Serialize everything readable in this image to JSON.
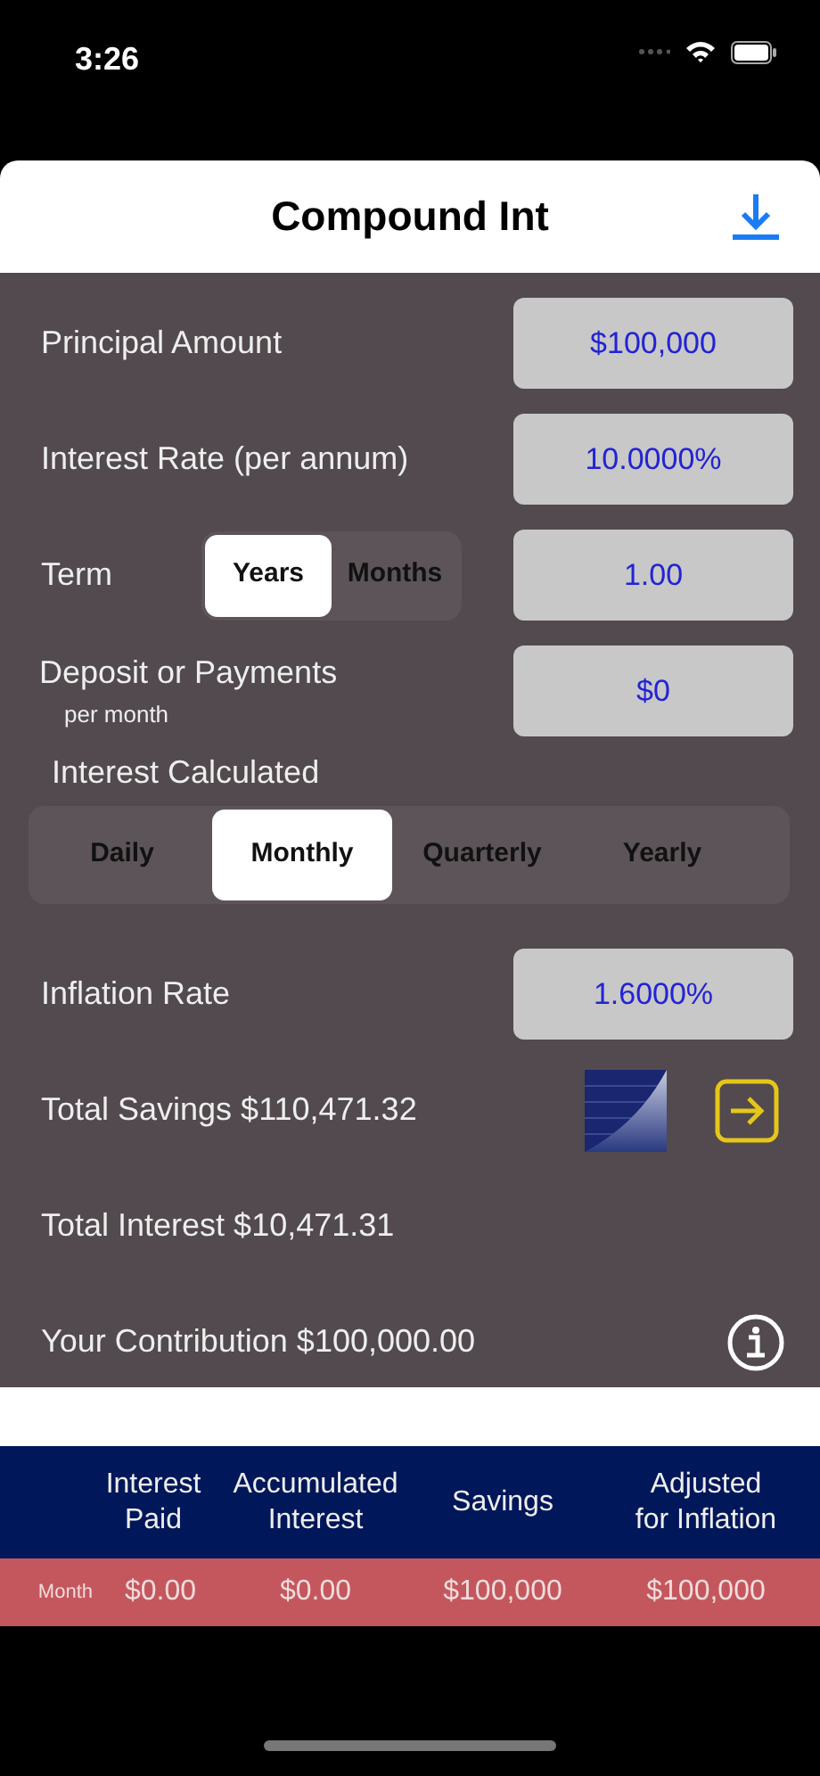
{
  "status_bar": {
    "time": "3:26"
  },
  "nav": {
    "title": "Compound Int"
  },
  "inputs": [
    {
      "label": "Principal Amount",
      "value": "$100,000"
    },
    {
      "label": "Interest Rate (per annum)",
      "value": "10.0000%"
    }
  ],
  "term": {
    "label": "Term",
    "options": [
      {
        "label": "Years",
        "selected": true
      },
      {
        "label": "Months",
        "selected": false
      }
    ],
    "value": "1.00"
  },
  "deposit": {
    "label": "Deposit or Payments",
    "sublabel": "per month",
    "value": "$0"
  },
  "interest_calculated": {
    "label": "Interest Calculated",
    "options": [
      {
        "label": "Daily",
        "selected": false
      },
      {
        "label": "Monthly",
        "selected": true
      },
      {
        "label": "Quarterly",
        "selected": false
      },
      {
        "label": "Yearly",
        "selected": false
      }
    ]
  },
  "inflation": {
    "label": "Inflation Rate",
    "value": "1.6000%"
  },
  "totals": [
    {
      "text": "Total Savings $110,471.32",
      "kind": "savings"
    },
    {
      "text": "Total Interest $10,471.31",
      "kind": "plain"
    },
    {
      "text": "Your Contribution $100,000.00",
      "kind": "info"
    }
  ],
  "table": {
    "columns": [
      "Interest\nPaid",
      "Accumulated\nInterest",
      "Savings",
      "Adjusted\nfor Inflation"
    ],
    "rows": [
      {
        "period": "Month",
        "cells": [
          "$0.00",
          "$0.00",
          "$100,000",
          "$100,000"
        ]
      }
    ]
  }
}
